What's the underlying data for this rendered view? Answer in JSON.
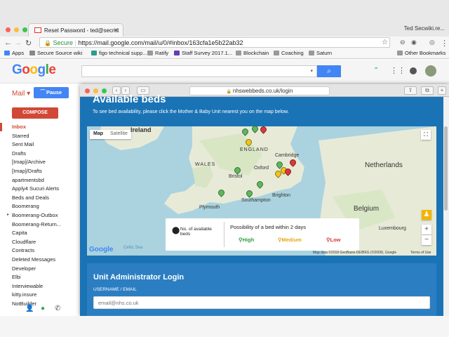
{
  "browser": {
    "tab_title": "Reset Password - ted@secret",
    "profile_name": "Ted Secwiki.re...",
    "secure_label": "Secure",
    "url": "https://mail.google.com/mail/u/0/#inbox/163cfa1e5b22ab32",
    "bookmarks": [
      {
        "label": "Apps",
        "color": "#4285f4"
      },
      {
        "label": "Secure Source wiki",
        "color": "#888888"
      },
      {
        "label": "figo technical supp...",
        "color": "#2a9d8f"
      },
      {
        "label": "Ratify",
        "color": "#999999"
      },
      {
        "label": "Staff Survey 2017.1...",
        "color": "#673ab7"
      },
      {
        "label": "Blockchain",
        "color": "#999999"
      },
      {
        "label": "Coaching",
        "color": "#999999"
      },
      {
        "label": "Saturn",
        "color": "#999999"
      },
      {
        "label": "Other Bookmarks",
        "color": "#999999"
      }
    ]
  },
  "gmail": {
    "logo": "Google",
    "mail_label": "Mail ▾",
    "pause_label": "Pause",
    "compose_label": "COMPOSE",
    "folders": [
      "Inbox",
      "Starred",
      "Sent Mail",
      "Drafts",
      "[Imap]/Archive",
      "[Imap]/Drafts",
      "apartmentsbd",
      "Apply4 Sucuri Alerts",
      "Beds and Deals",
      "Boomerang",
      "Boomerang-Outbox",
      "Boomerang-Return...",
      "Capita",
      "Cloudflare",
      "Contracts",
      "Deleted Messages",
      "Developer",
      "Elbi",
      "Interviewable",
      "kitty.insure",
      "NotBuilder"
    ]
  },
  "safari": {
    "url": "nhswebbeds.co.uk/login"
  },
  "site": {
    "title": "Available beds",
    "subtitle": "To see bed availability, please click the Mother & Baby Unit nearest you on the map below.",
    "map": {
      "toggle_map": "Map",
      "toggle_satellite": "Satellite",
      "labels": {
        "ireland": "Ireland",
        "england": "ENGLAND",
        "wales": "WALES",
        "cambridge": "Cambridge",
        "oxford": "Oxford",
        "bristol": "Bristol",
        "plymouth": "Plymouth",
        "southampton": "Southampton",
        "brighton": "Brighton",
        "netherlands": "Netherlands",
        "belgium": "Belgium",
        "luxembourg": "Luxembourg",
        "celtic_sea": "Celtic Sea",
        "google": "Google",
        "attribution": "Map data ©2018 GeoBasis-DE/BKG (©2009), Google",
        "terms": "Terms of Use"
      },
      "pin_colors": {
        "green": "#5cb85c",
        "yellow": "#f0c419",
        "red": "#d9383a"
      }
    },
    "legend": {
      "pin_label": "No. of available beds",
      "heading": "Possibility of a bed within 2 days",
      "high": "High",
      "medium": "Medium",
      "low": "Low",
      "high_color": "#2e9d3e",
      "medium_color": "#e6a817",
      "low_color": "#d9383a"
    },
    "login": {
      "title": "Unit Administrator Login",
      "username_label": "USERNAME / EMAIL",
      "username_placeholder": "email@nhs.co.uk"
    }
  }
}
